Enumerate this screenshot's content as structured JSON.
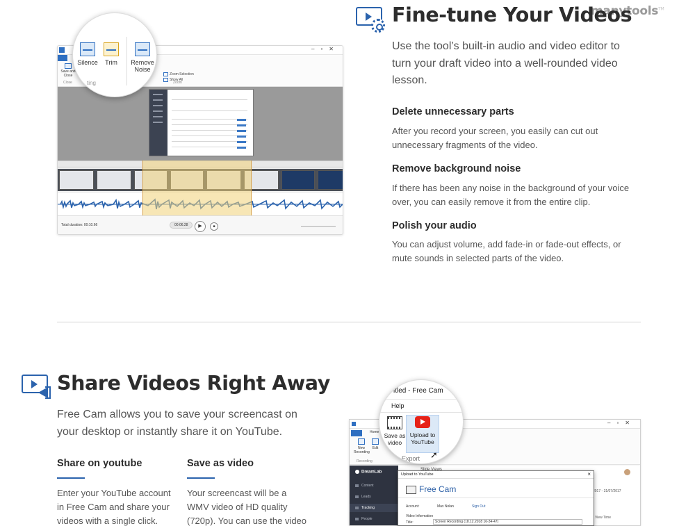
{
  "brand": {
    "logo_text": "manytools",
    "logo_mark": "TM"
  },
  "finetune": {
    "title": "Fine-tune Your Videos",
    "intro": "Use the tool’s built-in audio and video editor to turn your draft video into a well-rounded video lesson.",
    "features": [
      {
        "heading": "Delete unnecessary parts",
        "text": "After you record your screen, you easily can cut out unnecessary fragments of the video."
      },
      {
        "heading": "Remove background noise",
        "text": "If there has been any noise in the background of your voice over, you can easily remove it from the entire clip."
      },
      {
        "heading": "Polish your audio",
        "text": "You can adjust volume, add fade-in or fade-out effects, or mute sounds in selected parts of the video."
      }
    ]
  },
  "editor_shot": {
    "save_close": "Save and Close",
    "close_group": "Close",
    "zoom_selection": "Zoom Selection",
    "show_all": "Show All",
    "zoom_group": "Zoom",
    "total_duration": "Total duration: 00:10.66",
    "current_time": "00:06.28",
    "magnifier": {
      "silence": "Silence",
      "trim": "Trim",
      "remove_noise_1": "Remove",
      "remove_noise_2": "Noise",
      "group": "ting"
    }
  },
  "share": {
    "title": "Share Videos Right Away",
    "intro": "Free Cam allows you to save your screencast on your desktop or instantly share it on YouTube.",
    "col1": {
      "heading": "Share on youtube",
      "text": "Enter your YouTube account in Free Cam and share your videos with a single click."
    },
    "col2": {
      "heading": "Save as video",
      "text": "Your screencast will be a WMV video of HD quality (720p). You can use the video"
    }
  },
  "upload_shot": {
    "home_tab": "Home",
    "new_recording": "New Recording",
    "edit": "Edit",
    "recording_group": "Recording",
    "nav_brand": "DreamLab",
    "nav_items": [
      "Content",
      "Leads",
      "Tracking",
      "People"
    ],
    "slide_views": "Slide Views",
    "date_range": "2017 - 31/07/2017",
    "view_time": "View Time",
    "dialog_title": "Upload to YouTube",
    "dialog_brand": "Free Cam",
    "account_label": "Account:",
    "account_name": "Max Nolan",
    "sign_out": "Sign Out",
    "video_info": "Video Information",
    "title_label": "Title:",
    "title_value": "Screen Recording (18.12.2018 16-34-47)",
    "magnifier": {
      "window_title": "itled - Free Cam",
      "help": "Help",
      "save_as_1": "Save as",
      "save_as_2": "video",
      "upload_1": "Upload to",
      "upload_2": "YouTube",
      "export_group": "Export"
    }
  },
  "colors": {
    "accent": "#2b63ad",
    "heading": "#2d2d2d",
    "body": "#555555",
    "youtube": "#e62117"
  }
}
